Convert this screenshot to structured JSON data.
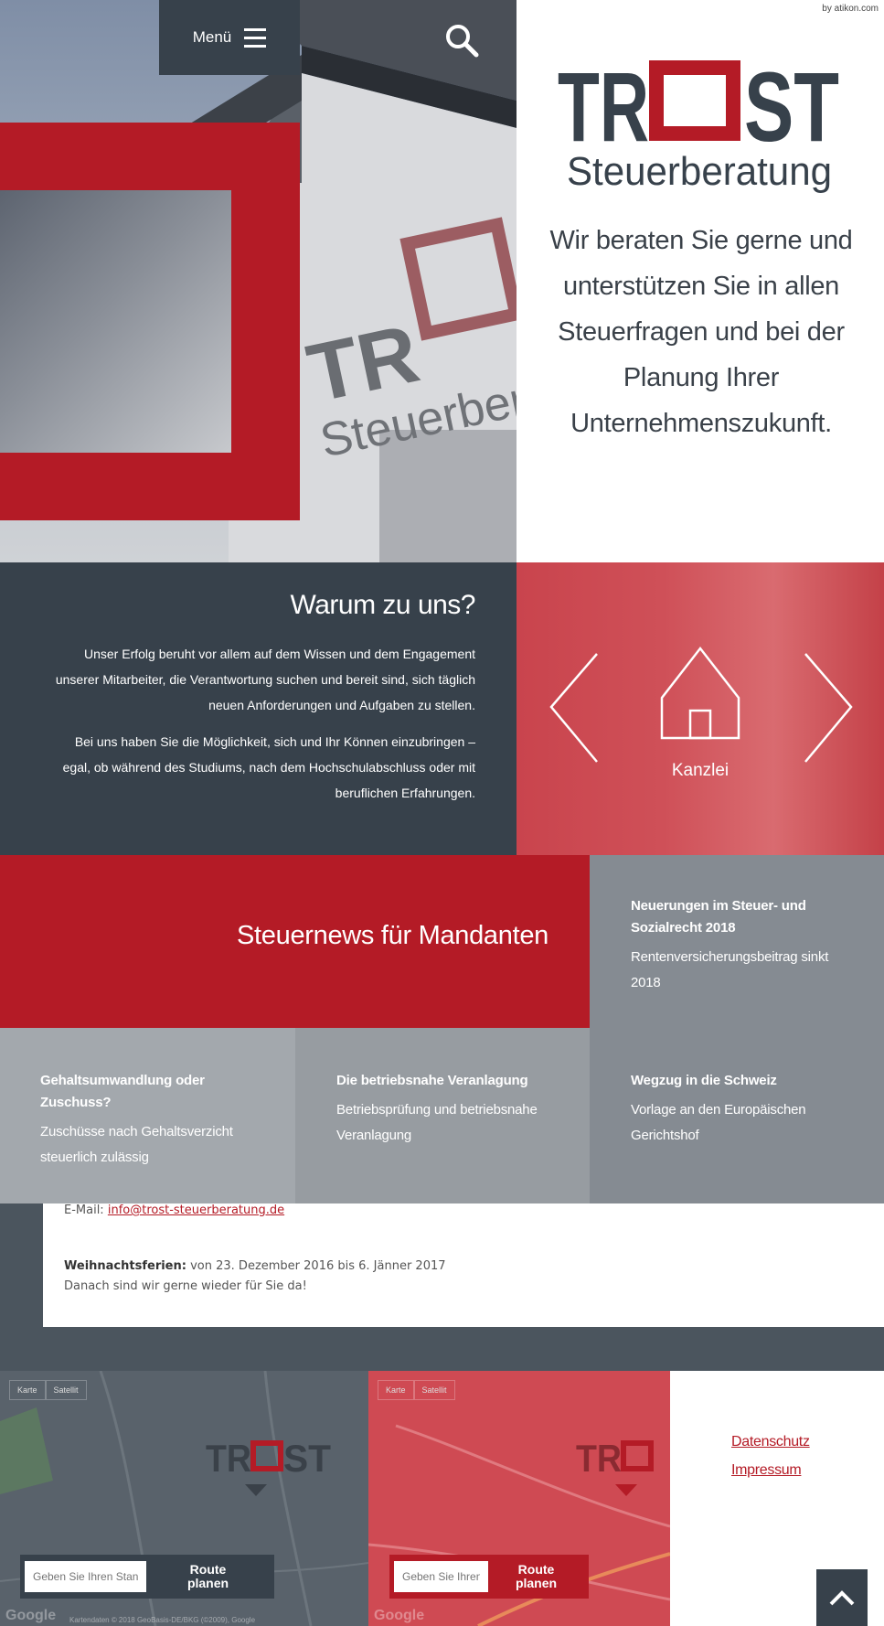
{
  "header": {
    "menu_label": "Menü",
    "credit": "by atikon.com"
  },
  "brand": {
    "logo_text": "TROST",
    "logo_sub": "Steuerberatung",
    "accent": "#b41b26",
    "dark": "#37414b"
  },
  "hero": {
    "tagline": "Wir beraten Sie gerne und unterstützen Sie in allen Steuerfragen und bei der Planung Ihrer Unternehmenszukunft."
  },
  "why": {
    "title": "Warum zu uns?",
    "p1": "Unser Erfolg beruht vor allem auf dem Wissen und dem Engagement unserer Mitarbeiter, die Verantwortung suchen und bereit sind, sich täglich neuen Anforderungen und Aufgaben zu stellen.",
    "p2": "Bei uns haben Sie die Möglichkeit, sich und Ihr Können einzubringen – egal, ob während des Studiums, nach dem Hochschulabschluss oder mit beruflichen Erfahrungen."
  },
  "slider": {
    "label": "Kanzlei"
  },
  "news": {
    "title": "Steuernews für Mandanten",
    "items": [
      {
        "title": "Neuerungen im Steuer- und Sozialrecht 2018",
        "text": "Rentenversicherungsbeitrag sinkt 2018"
      },
      {
        "title": "Gehaltsumwandlung oder Zuschuss?",
        "text": "Zuschüsse nach Gehaltsverzicht steuerlich zulässig"
      },
      {
        "title": "Die betriebsnahe Veranlagung",
        "text": "Betriebsprüfung und betriebsnahe Veranlagung"
      },
      {
        "title": "Wegzug in die Schweiz",
        "text": "Vorlage an den Europäischen Gerichtshof"
      }
    ]
  },
  "contact": {
    "email_label": "E-Mail:",
    "email": "info@trost-steuerberatung.de",
    "holiday_label": "Weihnachtsferien:",
    "holiday_text": "von 23. Dezember 2016 bis 6. Jänner 2017",
    "holiday_note": "Danach sind wir gerne wieder für Sie da!"
  },
  "maps": {
    "tab_map": "Karte",
    "tab_sat": "Satellit",
    "input_placeholder_1": "Geben Sie Ihren Standort",
    "input_placeholder_2": "Geben Sie Ihren Standort",
    "route_line1": "Route",
    "route_line2": "planen",
    "google": "Google",
    "attribution": "Kartendaten © 2018 GeoBasis-DE/BKG (©2009), Google"
  },
  "footer": {
    "links": [
      "Datenschutz",
      "Impressum"
    ]
  }
}
